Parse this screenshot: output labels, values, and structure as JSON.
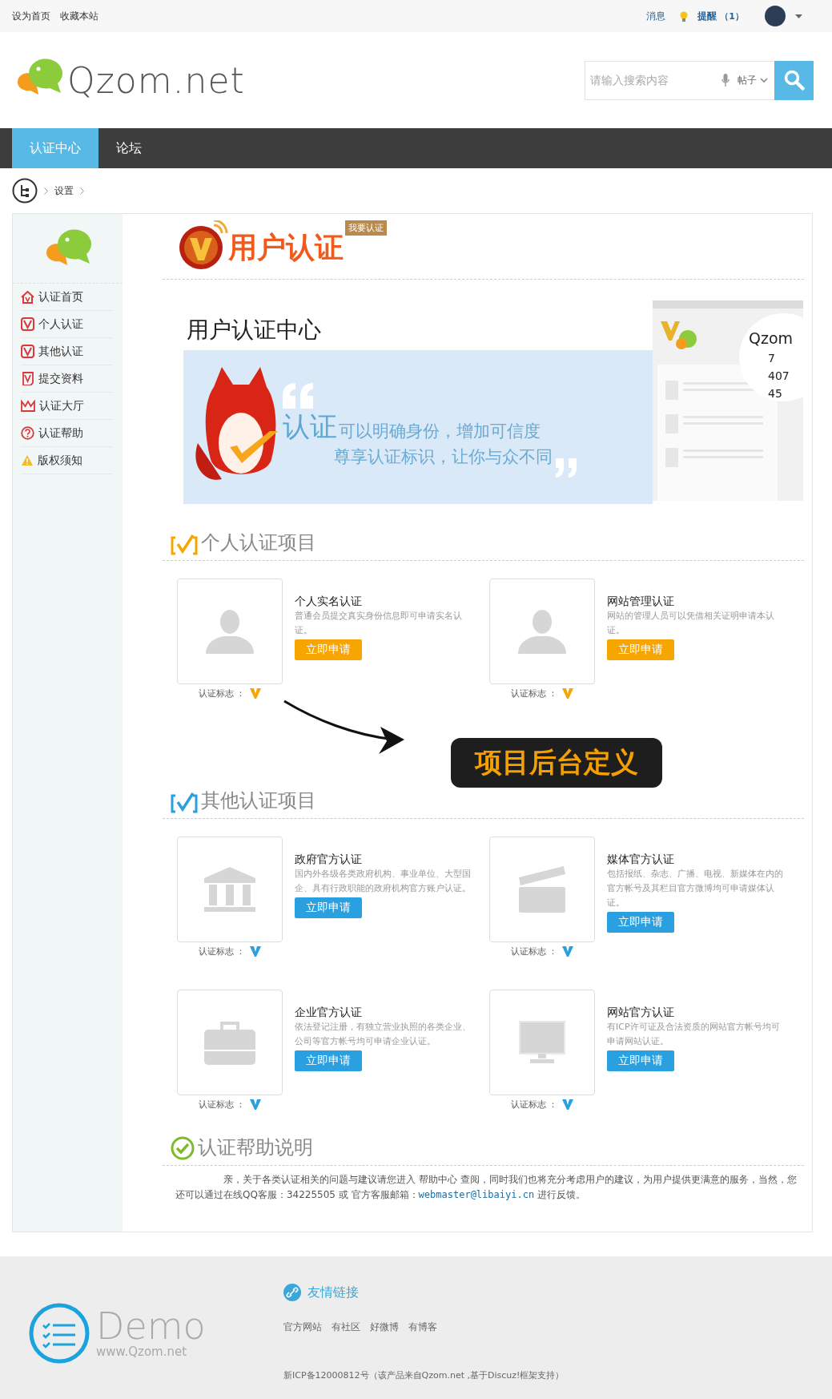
{
  "top_bar": {
    "links": [
      "设为首页",
      "收藏本站"
    ],
    "messages": "消息",
    "reminder": {
      "label": "提醒",
      "count": "（1）"
    }
  },
  "header": {
    "logo_text": "Qzom.net",
    "search": {
      "placeholder": "请输入搜索内容",
      "scope": "帖子"
    }
  },
  "nav": [
    {
      "label": "认证中心",
      "selected": true
    },
    {
      "label": "论坛",
      "selected": false
    }
  ],
  "breadcrumb": [
    "设置"
  ],
  "sidebar": {
    "items": [
      {
        "kind": "home",
        "label": "认证首页"
      },
      {
        "kind": "personal",
        "label": "个人认证"
      },
      {
        "kind": "other",
        "label": "其他认证"
      },
      {
        "kind": "submit",
        "label": "提交资料"
      },
      {
        "kind": "hall",
        "label": "认证大厅"
      },
      {
        "kind": "help",
        "label": "认证帮助"
      },
      {
        "kind": "notice",
        "label": "版权须知"
      }
    ]
  },
  "page_title": {
    "title": "用户认证",
    "badge": "我要认证"
  },
  "banner": {
    "heading": "用户认证中心",
    "highlight": "认证",
    "line1": "可以明确身份，增加可信度",
    "line2": "尊享认证标识，让你与众不同",
    "preview": {
      "brand": "Qzom",
      "stats": [
        "7",
        "407",
        "45"
      ]
    }
  },
  "sections": [
    {
      "kind": "personal",
      "title": "个人认证项目",
      "items": [
        {
          "kind": "person",
          "name": "个人实名认证",
          "description": "普通会员提交真实身份信息即可申请实名认证。",
          "button": "立即申请",
          "mark_label": "认证标志 ："
        },
        {
          "kind": "person",
          "name": "网站管理认证",
          "description": "网站的管理人员可以凭借相关证明申请本认证。",
          "button": "立即申请",
          "mark_label": "认证标志 ："
        }
      ]
    },
    {
      "kind": "other",
      "title": "其他认证项目",
      "items": [
        {
          "kind": "government",
          "name": "政府官方认证",
          "description": "国内外各级各类政府机构、事业单位、大型国企、具有行政职能的政府机构官方账户认证。",
          "button": "立即申请",
          "mark_label": "认证标志 ："
        },
        {
          "kind": "media",
          "name": "媒体官方认证",
          "description": "包括报纸、杂志、广播、电视、新媒体在内的官方帐号及其栏目官方微博均可申请媒体认证。",
          "button": "立即申请",
          "mark_label": "认证标志 ："
        },
        {
          "kind": "enterprise",
          "name": "企业官方认证",
          "description": "依法登记注册，有独立营业执照的各类企业、公司等官方帐号均可申请企业认证。",
          "button": "立即申请",
          "mark_label": "认证标志 ："
        },
        {
          "kind": "website",
          "name": "网站官方认证",
          "description": "有ICP许可证及合法资质的网站官方帐号均可申请网站认证。",
          "button": "立即申请",
          "mark_label": "认证标志 ："
        }
      ]
    }
  ],
  "annotation": {
    "callout": "项目后台定义"
  },
  "help": {
    "title": "认证帮助说明",
    "before": "亲，关于各类认证相关的问题与建议请您进入 帮助中心 查阅，同时我们也将充分考虑用户的建议，为用户提供更满意的服务，当然，您还可以通过在线QQ客服：34225505 或 官方客服邮箱：",
    "email": "webmaster@libaiyi.cn",
    "after": " 进行反馈。"
  },
  "footer": {
    "logo_word": "Demo",
    "logo_url": "www.Qzom.net",
    "links_title": "友情链接",
    "links": [
      "官方网站",
      "有社区",
      "好微博",
      "有博客"
    ],
    "icp": "新ICP备12000812号（该产品来自Qzom.net ,基于Discuz!框架支持）"
  }
}
